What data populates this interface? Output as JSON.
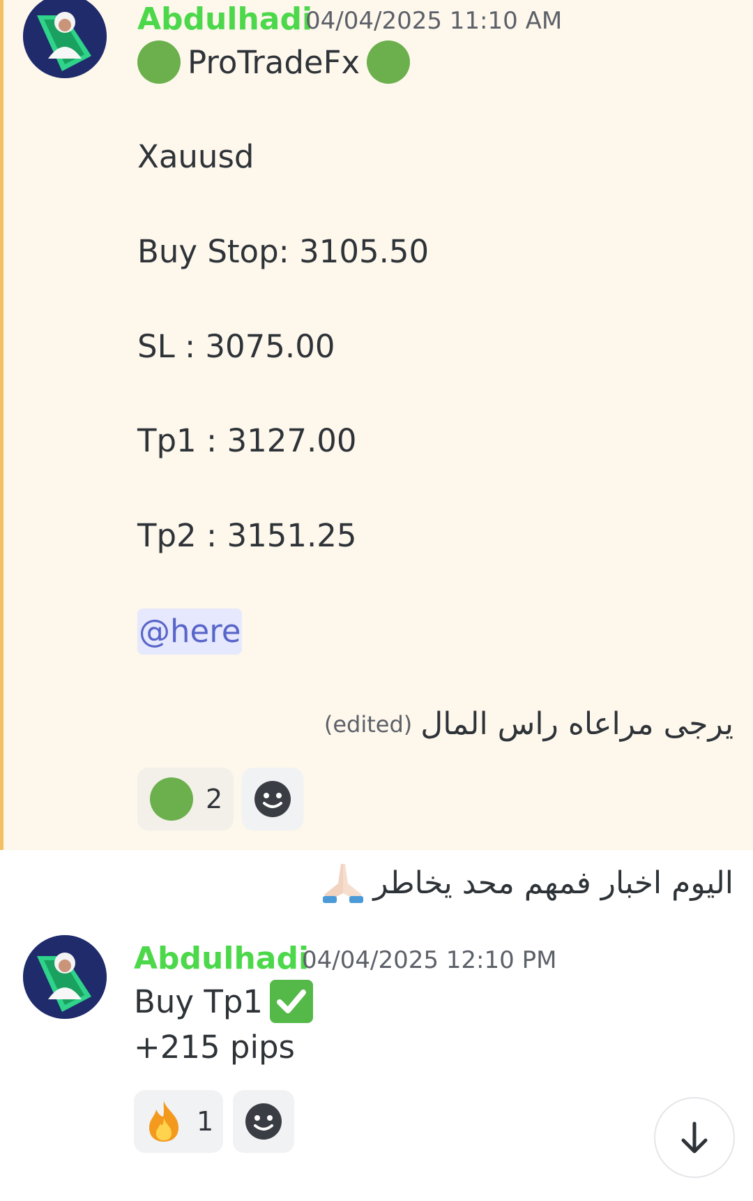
{
  "messages": [
    {
      "author": "Abdulhadi",
      "timestamp": "04/04/2025 11:10 AM",
      "header_text": "ProTradeFx",
      "lines": {
        "symbol": "Xauusd",
        "buy_stop": "Buy Stop:  3105.50",
        "sl": "SL :  3075.00",
        "tp1": "Tp1 : 3127.00",
        "tp2": "Tp2 : 3151.25"
      },
      "mention": "@here",
      "arabic_note": "يرجى مراعاه راس المال",
      "edited_label": "(edited)",
      "reactions": [
        {
          "emoji": "green-circle",
          "count": "2"
        }
      ],
      "highlight_color": "#f2c061"
    },
    {
      "arabic_followup": "اليوم اخبار فمهم محد يخاطر"
    },
    {
      "author": "Abdulhadi",
      "timestamp": "04/04/2025 12:10 PM",
      "line1": "Buy Tp1",
      "line2": "+215 pips",
      "reactions": [
        {
          "emoji": "fire",
          "count": "1"
        }
      ]
    }
  ],
  "colors": {
    "author": "#4cd84a",
    "mention_bg": "#e6e8fd",
    "mention_text": "#5865c9",
    "check_bg": "#54b948"
  }
}
